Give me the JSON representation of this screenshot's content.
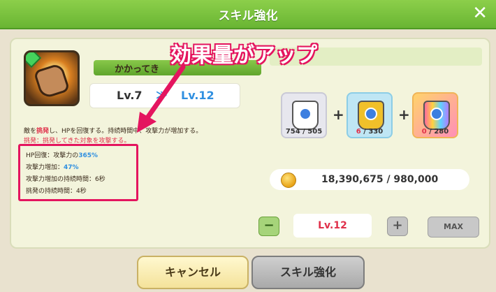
{
  "window": {
    "title": "スキル強化",
    "close_symbol": "✕"
  },
  "skill": {
    "name": "かかってき",
    "icon": "fist-skill-icon",
    "level_from": "Lv.7",
    "arrow": "≫",
    "level_to": "Lv.12",
    "desc_prefix": "敵を",
    "desc_highlight": "挑発",
    "desc_rest": "し、HPを回復する。持続時間中、攻撃力が増加する。",
    "desc_line2": "挑発：挑発してきた対象を攻撃する。",
    "effects": [
      {
        "label": "HP回復：攻撃力の",
        "value": "365%"
      },
      {
        "label": "攻撃力増加：",
        "value": "47%"
      },
      {
        "label": "攻撃力増加の持続時間：6秒",
        "value": ""
      },
      {
        "label": "挑発の持続時間：4秒",
        "value": ""
      }
    ]
  },
  "annotation": {
    "callout": "効果量がアップ",
    "color": "#e4155f"
  },
  "materials": [
    {
      "icon": "white-powder-jar-icon",
      "have": "754",
      "need": " / 505",
      "have_color": "#333333"
    },
    {
      "icon": "gold-powder-jar-icon",
      "have": "6",
      "need": " / 330",
      "have_color": "#e0304a"
    },
    {
      "icon": "rainbow-powder-jar-icon",
      "have": "0",
      "need": " / 280",
      "have_color": "#e0304a"
    }
  ],
  "coins": {
    "icon": "gold-coin-icon",
    "text": "18,390,675 / 980,000"
  },
  "level_control": {
    "minus": "−",
    "current": "Lv.12",
    "plus": "+",
    "max": "MAX"
  },
  "buttons": {
    "cancel": "キャンセル",
    "upgrade": "スキル強化"
  }
}
